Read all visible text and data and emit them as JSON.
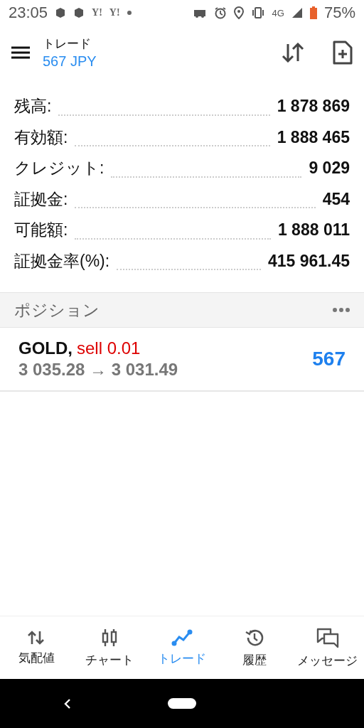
{
  "status_bar": {
    "time": "23:05",
    "notification_labels": [
      "Y!",
      "Y!"
    ],
    "network": "4G",
    "battery": "75%"
  },
  "header": {
    "title": "トレード",
    "subtitle": "567 JPY"
  },
  "account": [
    {
      "label": "残高:",
      "value": "1 878 869"
    },
    {
      "label": "有効額:",
      "value": "1 888 465"
    },
    {
      "label": "クレジット:",
      "value": "9 029"
    },
    {
      "label": "証拠金:",
      "value": "454"
    },
    {
      "label": "可能額:",
      "value": "1 888 011"
    },
    {
      "label": "証拠金率(%):",
      "value": "415 961.45"
    }
  ],
  "positions_section": {
    "title": "ポジション"
  },
  "positions": [
    {
      "symbol": "GOLD,",
      "order": "sell 0.01",
      "kind": "sell",
      "prices": "3 035.28 → 3 031.49",
      "profit": "567"
    }
  ],
  "tabs": [
    {
      "label": "気配値",
      "selected": false
    },
    {
      "label": "チャート",
      "selected": false
    },
    {
      "label": "トレード",
      "selected": true
    },
    {
      "label": "履歴",
      "selected": false
    },
    {
      "label": "メッセージ",
      "selected": false
    }
  ]
}
